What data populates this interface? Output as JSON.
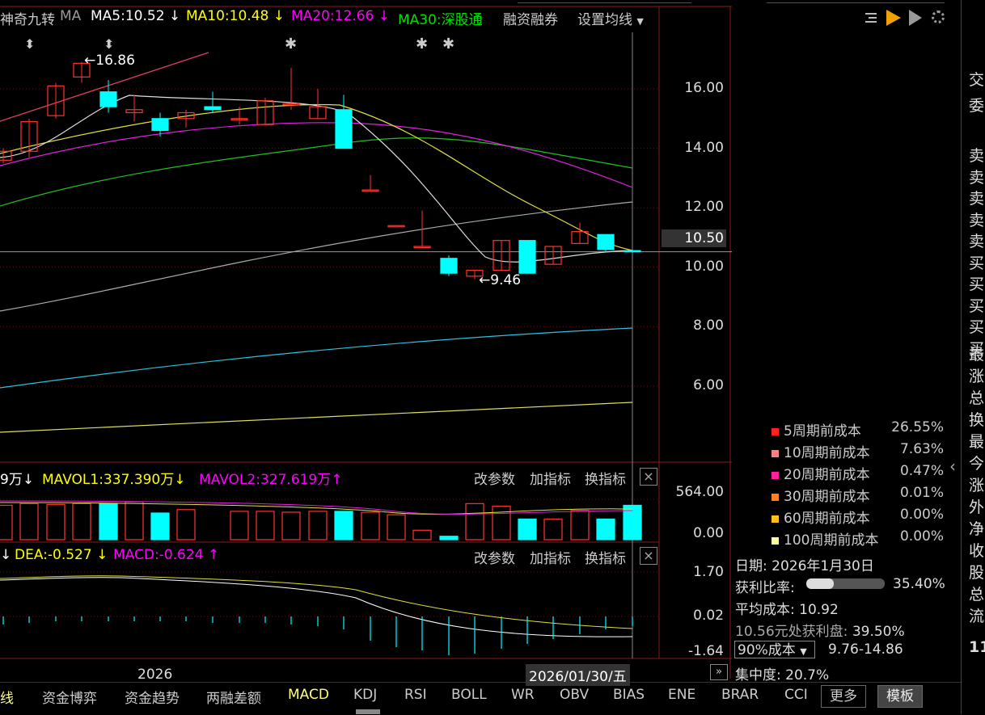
{
  "header": {
    "indicator_name": "神奇九转",
    "ma_label": "MA",
    "ma5": "MA5:10.52",
    "ma5_arrow": "↓",
    "ma10": "MA10:10.48",
    "ma10_arrow": "↓",
    "ma20": "MA20:12.66",
    "ma20_arrow": "↓",
    "ma30": "MA30:深股通",
    "margin": "融资融券",
    "settings": "设置均线"
  },
  "price_axis": [
    "16.00",
    "14.00",
    "12.00",
    "10.50",
    "10.00",
    "8.00",
    "6.00"
  ],
  "price_annotations": {
    "high": "16.86",
    "low": "9.46"
  },
  "volume": {
    "left_partial": "9万",
    "left_arrow": "↓",
    "mavol1": "MAVOL1:337.390万",
    "mavol1_arrow": "↓",
    "mavol2": "MAVOL2:327.619万",
    "mavol2_arrow": "↑",
    "axis_top": "564.00",
    "axis_bottom": "0.00",
    "values": [
      400,
      420,
      410,
      420,
      420,
      440,
      310,
      350,
      0,
      330,
      330,
      320,
      330,
      330,
      320,
      290,
      110,
      40,
      420,
      390,
      240,
      240,
      340,
      240,
      400,
      320,
      160
    ]
  },
  "macd": {
    "left_partial": "↓",
    "dea": "DEA:-0.527",
    "dea_arrow": "↓",
    "macd": "MACD:-0.624",
    "macd_arrow": "↑",
    "axis_top": "1.70",
    "axis_mid": "0.02",
    "axis_bottom": "-1.64"
  },
  "panel_controls": {
    "change_params": "改参数",
    "add_indicator": "加指标",
    "switch_indicator": "换指标",
    "close": "×"
  },
  "x_axis": {
    "year_label": "2026",
    "cursor_date": "2026/01/30/五"
  },
  "cost_legend": [
    {
      "label": "5周期前成本",
      "value": "26.55%",
      "color": "#ff2020"
    },
    {
      "label": "10周期前成本",
      "value": "7.63%",
      "color": "#ff8080"
    },
    {
      "label": "20周期前成本",
      "value": "0.47%",
      "color": "#ff20a0"
    },
    {
      "label": "30周期前成本",
      "value": "0.01%",
      "color": "#ff8020"
    },
    {
      "label": "60周期前成本",
      "value": "0.00%",
      "color": "#ffc020"
    },
    {
      "label": "100周期前成本",
      "value": "0.00%",
      "color": "#ffffa0"
    }
  ],
  "chip_stats": {
    "date_label": "日期:",
    "date": "2026年1月30日",
    "profit_ratio_label": "获利比率:",
    "profit_ratio": "35.40%",
    "profit_ratio_fraction": 0.354,
    "avg_cost_label": "平均成本:",
    "avg_cost": "10.92",
    "profit_at_price": "10.56元处获利盘:",
    "profit_at_price_value": "39.50%",
    "cost_select": "90%成本",
    "cost_range": "9.76-14.86",
    "concentration_label": "集中度:",
    "concentration": "20.7%"
  },
  "bottom_tabs": [
    "线",
    "资金博弈",
    "资金趋势",
    "两融差额",
    "MACD",
    "KDJ",
    "RSI",
    "BOLL",
    "WR",
    "OBV",
    "BIAS",
    "ENE",
    "BRAR",
    "CCI",
    "更多",
    "模板"
  ],
  "active_tab": "MACD",
  "right_strip": [
    "交",
    "委",
    "卖",
    "卖",
    "卖",
    "卖",
    "卖",
    "买",
    "买",
    "买",
    "买",
    "买",
    "最",
    "涨",
    "总",
    "换",
    "最",
    "今",
    "涨",
    "外",
    "净",
    "收",
    "股",
    "总",
    "流"
  ],
  "right_strip_bottom": "11",
  "colors": {
    "up": "#ff3232",
    "down": "#00ffff",
    "ma5": "#ffffff",
    "ma10": "#ffff00",
    "ma20": "#ff00ff",
    "ma30": "#00e000"
  }
}
